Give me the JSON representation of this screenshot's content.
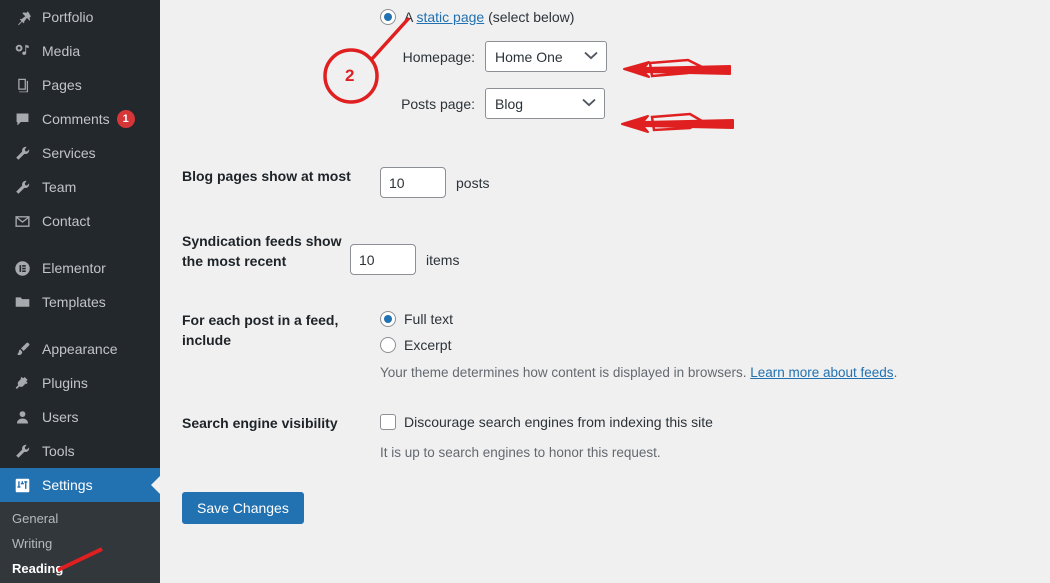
{
  "sidebar": {
    "items": [
      {
        "label": "Portfolio",
        "icon": "pushpin-icon",
        "active": false,
        "badge": null
      },
      {
        "label": "Media",
        "icon": "media-icon",
        "active": false,
        "badge": null
      },
      {
        "label": "Pages",
        "icon": "pages-icon",
        "active": false,
        "badge": null
      },
      {
        "label": "Comments",
        "icon": "comment-icon",
        "active": false,
        "badge": "1"
      },
      {
        "label": "Services",
        "icon": "wrench-icon",
        "active": false,
        "badge": null
      },
      {
        "label": "Team",
        "icon": "wrench-icon",
        "active": false,
        "badge": null
      },
      {
        "label": "Contact",
        "icon": "envelope-icon",
        "active": false,
        "badge": null
      },
      {
        "label": "Elementor",
        "icon": "elementor-icon",
        "active": false,
        "badge": null,
        "gap_before": true
      },
      {
        "label": "Templates",
        "icon": "folder-icon",
        "active": false,
        "badge": null
      },
      {
        "label": "Appearance",
        "icon": "brush-icon",
        "active": false,
        "badge": null,
        "gap_before": true
      },
      {
        "label": "Plugins",
        "icon": "plug-icon",
        "active": false,
        "badge": null
      },
      {
        "label": "Users",
        "icon": "user-icon",
        "active": false,
        "badge": null
      },
      {
        "label": "Tools",
        "icon": "wrench-icon",
        "active": false,
        "badge": null
      },
      {
        "label": "Settings",
        "icon": "settings-icon",
        "active": true,
        "badge": null
      }
    ],
    "submenu": [
      {
        "label": "General",
        "current": false
      },
      {
        "label": "Writing",
        "current": false
      },
      {
        "label": "Reading",
        "current": true
      }
    ],
    "colors": {
      "background": "#23282d",
      "submenu_background": "#32373c",
      "active": "#2271b1",
      "badge": "#d63638"
    }
  },
  "main": {
    "front_page": {
      "radio_static_prefix": "A ",
      "radio_static_link": "static page",
      "radio_static_suffix": " (select below)",
      "static_selected": true,
      "homepage_label": "Homepage:",
      "homepage_value": "Home One",
      "homepage_options": [
        "Home One"
      ],
      "posts_page_label": "Posts page:",
      "posts_page_value": "Blog",
      "posts_page_options": [
        "Blog"
      ]
    },
    "blog_pages": {
      "label": "Blog pages show at most",
      "value": "10",
      "unit": "posts"
    },
    "syndication": {
      "label": "Syndication feeds show the most recent",
      "value": "10",
      "unit": "items"
    },
    "feed_include": {
      "label": "For each post in a feed, include",
      "options": [
        {
          "label": "Full text",
          "selected": true
        },
        {
          "label": "Excerpt",
          "selected": false
        }
      ],
      "help_text": "Your theme determines how content is displayed in browsers. ",
      "help_link": "Learn more about feeds",
      "help_suffix": "."
    },
    "search_visibility": {
      "label": "Search engine visibility",
      "checkbox_label": "Discourage search engines from indexing this site",
      "checked": false,
      "note": "It is up to search engines to honor this request."
    },
    "save_label": "Save Changes"
  },
  "annotations": {
    "accent_color": "#e02020",
    "step_badge": "2"
  }
}
